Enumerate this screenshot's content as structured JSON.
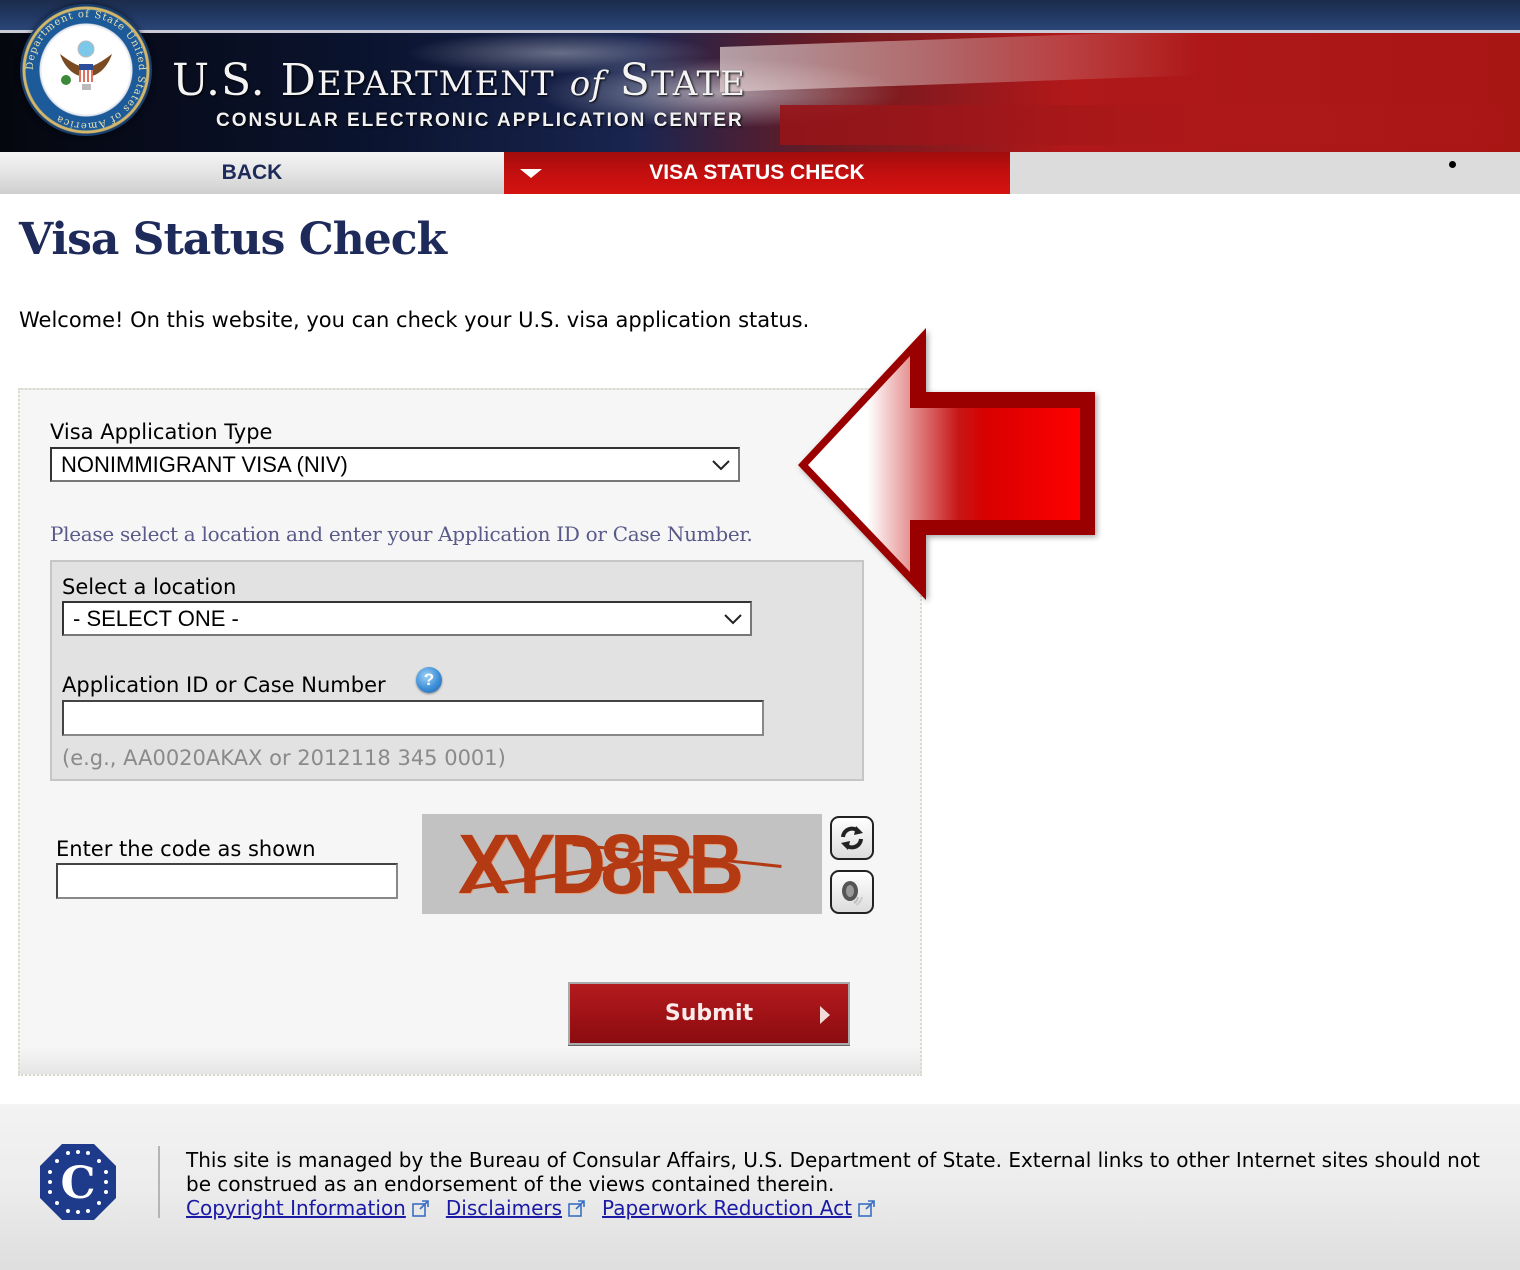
{
  "header": {
    "seal_name": "Department of State United States of America",
    "title_part1": "U.S. D",
    "title_part2": "EPARTMENT",
    "title_of": "of",
    "title_part3": "S",
    "title_part4": "TATE",
    "subtitle": "CONSULAR ELECTRONIC APPLICATION CENTER"
  },
  "nav": {
    "back_label": "BACK",
    "active_label": "VISA STATUS CHECK",
    "active_color": "#c30f0f"
  },
  "main": {
    "page_title": "Visa Status Check",
    "welcome_text": "Welcome! On this website, you can check your U.S. visa application status.",
    "visa_type": {
      "label": "Visa Application Type",
      "selected": "NONIMMIGRANT VISA (NIV)"
    },
    "instruction": "Please select a location and enter your Application ID or Case Number.",
    "location": {
      "label": "Select a location",
      "selected": "- SELECT ONE -"
    },
    "application_id": {
      "label": "Application ID or Case Number",
      "value": "",
      "hint": "(e.g., AA0020AKAX or 2012118 345 0001)",
      "help_icon": "?"
    },
    "captcha": {
      "label": "Enter the code as shown",
      "value": "",
      "image_text": "XYD8RB",
      "refresh_icon": "refresh-icon",
      "audio_icon": "speaker-icon"
    },
    "submit_label": "Submit"
  },
  "footer": {
    "logo_letter": "C",
    "text": "This site is managed by the Bureau of Consular Affairs, U.S. Department of State. External links to other Internet sites should not be construed as an endorsement of the views contained therein.",
    "links": [
      {
        "label": "Copyright Information"
      },
      {
        "label": "Disclaimers"
      },
      {
        "label": "Paperwork Reduction Act"
      }
    ]
  }
}
